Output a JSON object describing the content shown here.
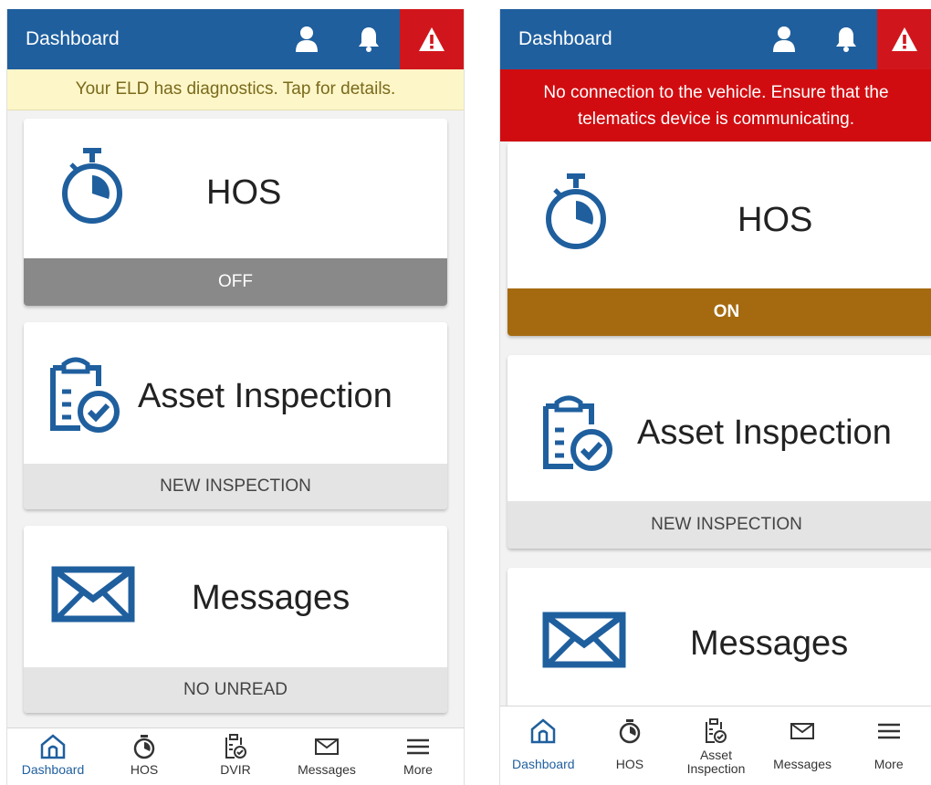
{
  "colors": {
    "brand_blue": "#1f5f9e",
    "alert_red": "#d10c10",
    "off_gray": "#898989",
    "on_gold": "#a56a10",
    "warning_yellow": "#fdf6c8"
  },
  "left": {
    "header": {
      "title": "Dashboard",
      "icons": [
        "user-icon",
        "bell-icon",
        "warning-icon"
      ]
    },
    "banner": "Your ELD has diagnostics. Tap for details.",
    "cards": {
      "hos": {
        "title": "HOS",
        "status": "OFF",
        "icon": "stopwatch-icon"
      },
      "asset": {
        "title": "Asset Inspection",
        "status": "NEW INSPECTION",
        "icon": "clipboard-check-icon"
      },
      "messages": {
        "title": "Messages",
        "status": "NO UNREAD",
        "icon": "envelope-icon"
      }
    },
    "nav": {
      "dashboard": "Dashboard",
      "hos": "HOS",
      "dvir": "DVIR",
      "messages": "Messages",
      "more": "More"
    }
  },
  "right": {
    "header": {
      "title": "Dashboard",
      "icons": [
        "user-icon",
        "bell-icon",
        "warning-icon"
      ]
    },
    "banner": {
      "line1": "No connection to the vehicle. Ensure that the",
      "line2": "telematics device is communicating."
    },
    "cards": {
      "hos": {
        "title": "HOS",
        "status": "ON",
        "icon": "stopwatch-icon"
      },
      "asset": {
        "title": "Asset Inspection",
        "status": "NEW INSPECTION",
        "icon": "clipboard-check-icon"
      },
      "messages": {
        "title": "Messages",
        "icon": "envelope-icon"
      }
    },
    "nav": {
      "dashboard": "Dashboard",
      "hos": "HOS",
      "asset_line1": "Asset",
      "asset_line2": "Inspection",
      "messages": "Messages",
      "more": "More"
    }
  }
}
